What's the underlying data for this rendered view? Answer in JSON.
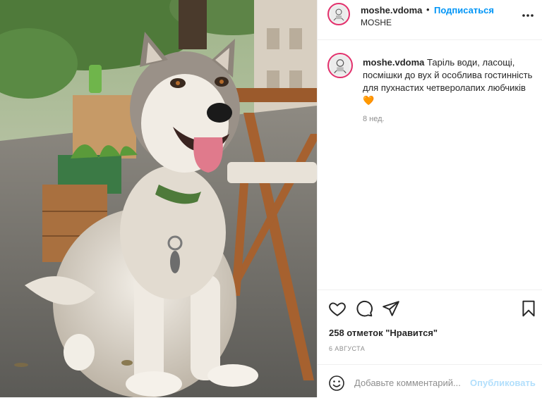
{
  "header": {
    "username": "moshe.vdoma",
    "separator": "•",
    "follow_label": "Подписаться",
    "subtitle": "MOSHE",
    "more_icon": "more-horizontal-icon"
  },
  "caption": {
    "username": "moshe.vdoma",
    "text": "Таріль води, ласощі, посмішки до вух й особлива гостинність для пухнастих четверолапих любчиків",
    "emoji": "🧡",
    "age": "8 нед."
  },
  "actions": {
    "like_icon": "heart-icon",
    "comment_icon": "comment-icon",
    "share_icon": "share-icon",
    "save_icon": "bookmark-icon"
  },
  "likes": "258 отметок \"Нравится\"",
  "date": "6 АВГУСТА",
  "comment": {
    "placeholder": "Добавьте комментарий...",
    "publish_label": "Опубликовать",
    "emoji_icon": "smile-icon"
  },
  "colors": {
    "link_blue": "#0095f6",
    "publish_disabled": "#b2dffc",
    "secondary_text": "#8e8e8e",
    "avatar_ring": "#e3306c"
  }
}
